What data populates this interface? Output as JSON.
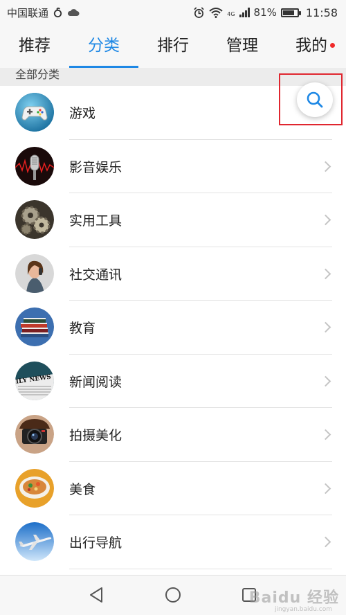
{
  "status_bar": {
    "carrier": "中国联通",
    "battery_percent": "81%",
    "battery_level": 0.81,
    "network_label": "4G",
    "time": "11:58"
  },
  "tabs": [
    {
      "label": "推荐",
      "active": false
    },
    {
      "label": "分类",
      "active": true
    },
    {
      "label": "排行",
      "active": false
    },
    {
      "label": "管理",
      "active": false
    },
    {
      "label": "我的",
      "active": false,
      "badge_dot": true
    }
  ],
  "section": {
    "title": "全部分类"
  },
  "categories": [
    {
      "label": "游戏",
      "icon": "gamepad-icon"
    },
    {
      "label": "影音娱乐",
      "icon": "microphone-icon"
    },
    {
      "label": "实用工具",
      "icon": "gears-icon"
    },
    {
      "label": "社交通讯",
      "icon": "phone-call-icon"
    },
    {
      "label": "教育",
      "icon": "books-icon"
    },
    {
      "label": "新闻阅读",
      "icon": "newspaper-icon"
    },
    {
      "label": "拍摄美化",
      "icon": "camera-icon"
    },
    {
      "label": "美食",
      "icon": "food-bowl-icon"
    },
    {
      "label": "出行导航",
      "icon": "airplane-icon"
    }
  ],
  "newspaper_text": "ILY NEWS",
  "search": {
    "icon": "search-icon",
    "highlight_color": "#e0262f"
  },
  "colors": {
    "accent": "#1e88e5",
    "badge": "#f02a2a"
  },
  "watermark": {
    "main": "Baidu 经验",
    "sub": "jingyan.baidu.com"
  }
}
